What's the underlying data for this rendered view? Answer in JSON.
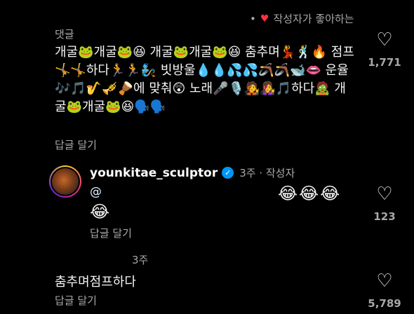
{
  "header": {
    "bullet": "•",
    "heart": "♥",
    "liked_by_author": "작성자가 좋아하는"
  },
  "comment1": {
    "label": "댓글",
    "text": "개굴🐸개굴🐸😆 개굴🐸개굴🐸😆 춤추며💃🕺🔥 점프🤸🤸하다🏃🏃🧞 빗방울💧💧💦💦🪃🪃🐋👄 운율🎶🎵🎷🎺🪘에 맞춰😲 노래🎤🎙️🧑‍🎤👩‍🎤🎵하다🧟 개굴🐸개굴🐸😆🗣️🗣️",
    "reply_label": "답글 달기",
    "likes": "1,771"
  },
  "comment2": {
    "username": "younkitae_sculptor",
    "verified_mark": "✓",
    "meta": "3주 · 작성자",
    "mention": "@",
    "emojis_a": "😂😂😂",
    "emojis_b": "😂",
    "reply_label": "답글 달기",
    "likes": "123"
  },
  "comment3": {
    "time": "3주",
    "text": "춤추며점프하다",
    "reply_label": "답글 달기",
    "likes": "5,789"
  },
  "icons": {
    "like": "heart-outline-icon",
    "verified": "verified-badge-icon"
  },
  "colors": {
    "background": "#000000",
    "verified": "#0095f6",
    "liked_heart": "#ff3040",
    "secondary_text": "#a8a8a8"
  }
}
